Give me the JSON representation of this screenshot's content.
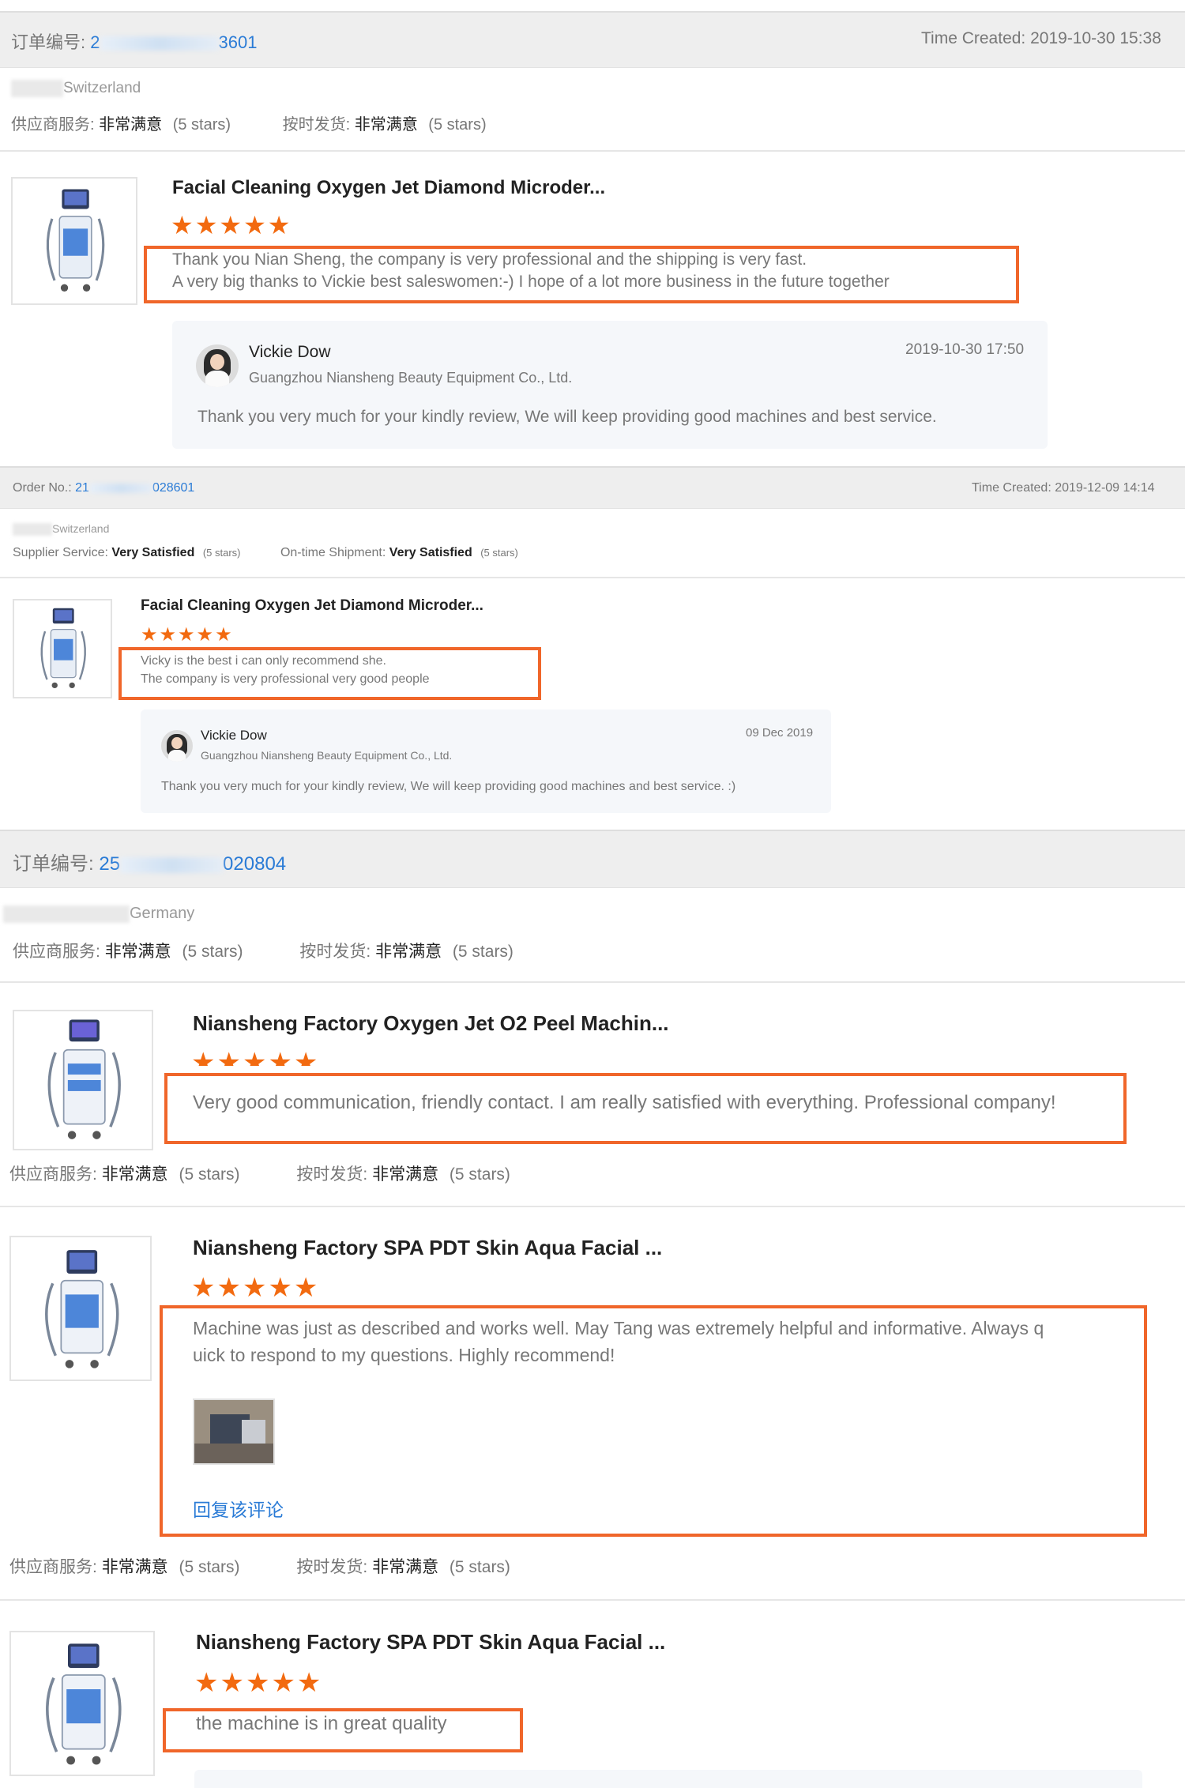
{
  "review1": {
    "order_label": "订单编号:",
    "order_prefix": "2",
    "order_suffix": "3601",
    "time_created": "Time Created: 2019-10-30 15:38",
    "country": "Switzerland",
    "supplier_label": "供应商服务:",
    "supplier_value": "非常满意",
    "supplier_stars": "(5 stars)",
    "shipment_label": "按时发货:",
    "shipment_value": "非常满意",
    "shipment_stars": "(5 stars)",
    "product_title": "Facial Cleaning Oxygen Jet Diamond Microder...",
    "stars": "★★★★★",
    "review_line1": "Thank you Nian Sheng, the company is very professional and the shipping is very fast.",
    "review_line2": "A very big thanks to Vickie best saleswomen:-) I hope of a lot more business in the future together",
    "reply_name": "Vickie Dow",
    "reply_date": "2019-10-30 17:50",
    "reply_company": "Guangzhou Niansheng Beauty Equipment Co., Ltd.",
    "reply_text": "Thank you very much for your kindly review, We will keep providing good machines and best service."
  },
  "review2": {
    "order_label": "Order No.:",
    "order_prefix": "21",
    "order_suffix": "028601",
    "time_created": "Time Created: 2019-12-09 14:14",
    "country": "Switzerland",
    "supplier_label": "Supplier Service:",
    "supplier_value": "Very Satisfied",
    "supplier_stars": "(5 stars)",
    "shipment_label": "On-time Shipment:",
    "shipment_value": "Very Satisfied",
    "shipment_stars": "(5 stars)",
    "product_title": "Facial Cleaning Oxygen Jet Diamond Microder...",
    "stars": "★★★★★",
    "review_line1": "Vicky is the best i can only recommend she.",
    "review_line2": "The company is very professional very good people",
    "reply_name": "Vickie Dow",
    "reply_date": "09 Dec 2019",
    "reply_company": "Guangzhou Niansheng Beauty Equipment Co., Ltd.",
    "reply_text": "Thank you very much for your kindly review, We will keep providing good machines and best service. :)"
  },
  "order3": {
    "order_label": "订单编号:",
    "order_prefix": "25",
    "order_suffix": "020804",
    "country": "Germany",
    "supplier_label": "供应商服务:",
    "supplier_value": "非常满意",
    "supplier_stars": "(5 stars)",
    "shipment_label": "按时发货:",
    "shipment_value": "非常满意",
    "shipment_stars": "(5 stars)",
    "item1": {
      "product_title": "Niansheng Factory Oxygen Jet O2 Peel Machin...",
      "stars": "★★★★★",
      "review_text": "Very good communication, friendly contact. I am really satisfied with everything. Professional company!",
      "supplier_label": "供应商服务:",
      "supplier_value": "非常满意",
      "supplier_stars": "(5 stars)",
      "shipment_label": "按时发货:",
      "shipment_value": "非常满意",
      "shipment_stars": "(5 stars)"
    },
    "item2": {
      "product_title": "Niansheng Factory SPA PDT Skin Aqua Facial ...",
      "stars": "★★★★★",
      "review_line1": "Machine was just as described and works well. May Tang was extremely helpful and informative. Always q",
      "review_line2": "uick to respond to my questions. Highly recommend!",
      "reply_link": "回复该评论",
      "supplier_label": "供应商服务:",
      "supplier_value": "非常满意",
      "supplier_stars": "(5 stars)",
      "shipment_label": "按时发货:",
      "shipment_value": "非常满意",
      "shipment_stars": "(5 stars)"
    },
    "item3": {
      "product_title": "Niansheng Factory SPA PDT Skin Aqua Facial ...",
      "stars": "★★★★★",
      "review_text": "the machine is in great quality"
    }
  }
}
